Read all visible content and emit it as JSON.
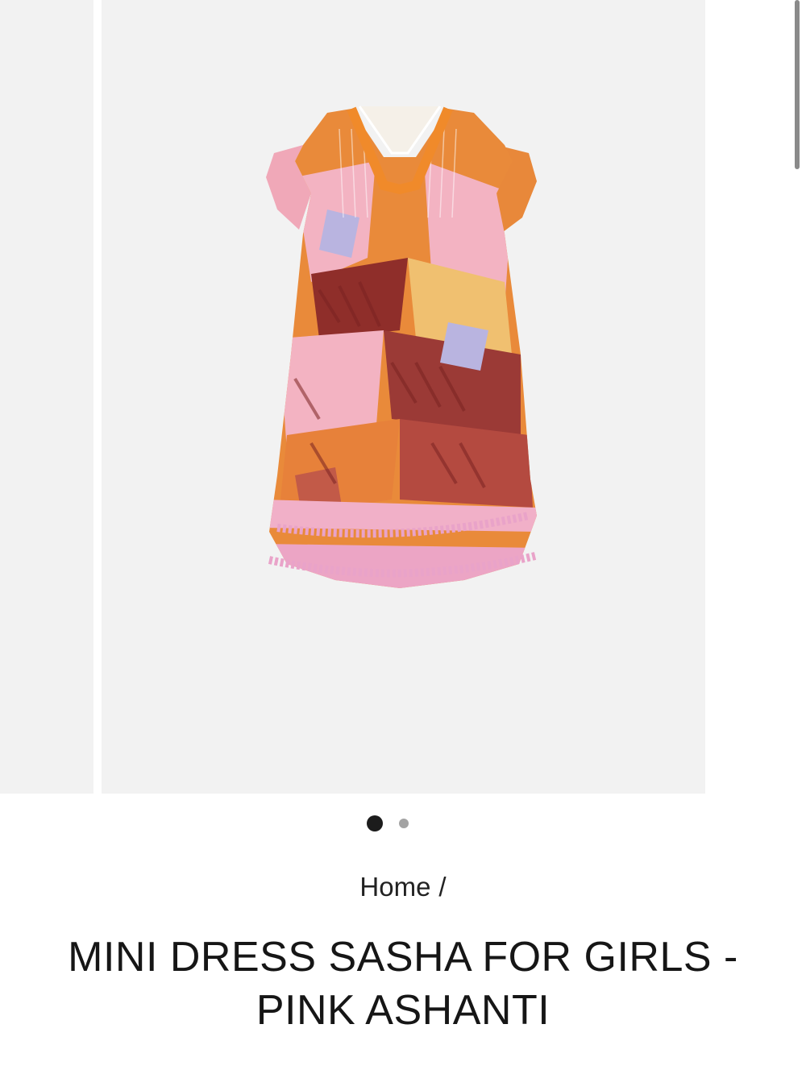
{
  "gallery": {
    "product_image_alt": "Mini dress Sasha for girls - Pink Ashanti",
    "zoom_icon": "search-icon",
    "slides_total": 2,
    "active_slide": 1
  },
  "breadcrumb": {
    "home_label": "Home",
    "separator": "/"
  },
  "product": {
    "title": "MINI DRESS SASHA FOR GIRLS - PINK ASHANTI"
  },
  "colors": {
    "gallery_bg": "#f2f2f2",
    "dot_active": "#1c1c1c",
    "dot_inactive": "#a3a3a3",
    "text": "#161616"
  }
}
